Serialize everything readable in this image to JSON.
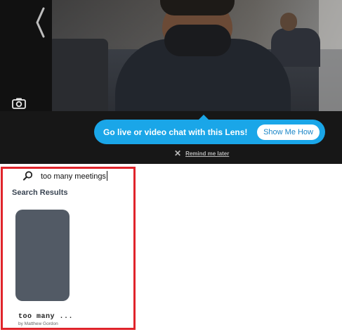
{
  "camera": {
    "back_icon": "chevron-left-icon",
    "camera_icon": "camera-icon"
  },
  "lens_banner": {
    "text": "Go live or video chat with this Lens!",
    "button_label": "Show Me How",
    "remind_label": "Remind me later",
    "close_icon": "close-icon",
    "accent": "#1aa6e8"
  },
  "search": {
    "icon": "search-icon",
    "query": "too many meetings"
  },
  "results": {
    "title": "Search Results",
    "items": [
      {
        "title": "too many ...",
        "author": "by Matthew Gordon",
        "thumb_color": "#525a65"
      }
    ]
  },
  "highlight_color": "#e0242b"
}
